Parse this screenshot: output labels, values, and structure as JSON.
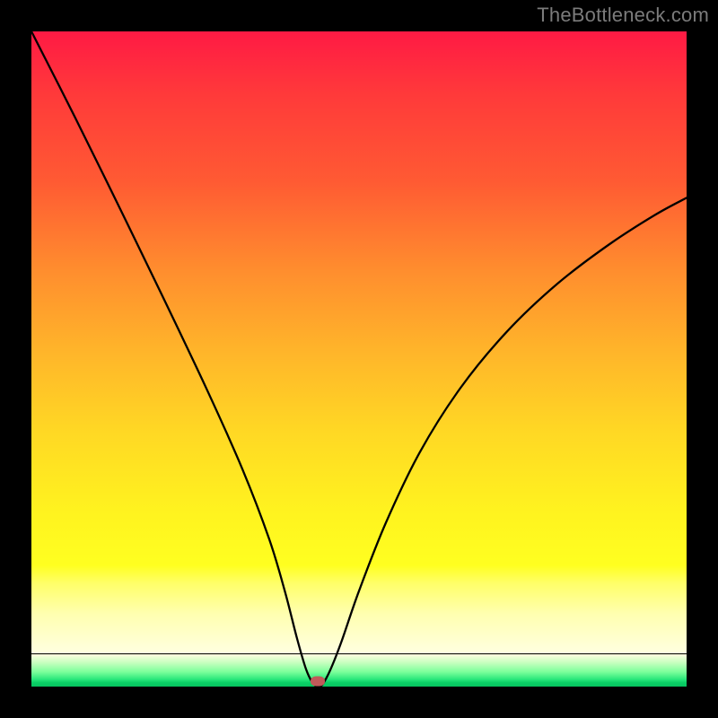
{
  "watermark": "TheBottleneck.com",
  "chart_data": {
    "type": "line",
    "title": "",
    "xlabel": "",
    "ylabel": "",
    "xlim": [
      0,
      100
    ],
    "ylim": [
      0,
      100
    ],
    "background_gradient": {
      "stops": [
        {
          "pos": 0.0,
          "color": "#ff1a44"
        },
        {
          "pos": 0.25,
          "color": "#ff6a30"
        },
        {
          "pos": 0.5,
          "color": "#ffb52a"
        },
        {
          "pos": 0.7,
          "color": "#fff31f"
        },
        {
          "pos": 0.815,
          "color": "#ffff20"
        },
        {
          "pos": 0.94,
          "color": "#ffffe0"
        },
        {
          "pos": 0.965,
          "color": "#7aff9a"
        },
        {
          "pos": 1.0,
          "color": "#07c25f"
        }
      ]
    },
    "series": [
      {
        "name": "bottleneck-curve",
        "stroke": "#000000",
        "stroke_width": 2.3,
        "path_xy": [
          [
            0.0,
            100.0
          ],
          [
            6.7,
            86.8
          ],
          [
            13.4,
            73.2
          ],
          [
            20.0,
            59.6
          ],
          [
            26.8,
            45.3
          ],
          [
            32.2,
            33.2
          ],
          [
            36.3,
            22.5
          ],
          [
            38.7,
            14.5
          ],
          [
            40.5,
            7.5
          ],
          [
            41.9,
            2.7
          ],
          [
            42.9,
            0.6
          ],
          [
            43.7,
            0.0
          ],
          [
            44.4,
            0.3
          ],
          [
            45.6,
            2.5
          ],
          [
            47.3,
            6.8
          ],
          [
            50.0,
            14.6
          ],
          [
            54.1,
            25.0
          ],
          [
            59.3,
            35.8
          ],
          [
            65.5,
            45.6
          ],
          [
            72.6,
            54.2
          ],
          [
            80.3,
            61.5
          ],
          [
            88.2,
            67.5
          ],
          [
            95.2,
            72.0
          ],
          [
            100.0,
            74.6
          ]
        ]
      }
    ],
    "marker": {
      "x": 43.7,
      "y": 0.8,
      "color": "#c15a5a"
    }
  }
}
